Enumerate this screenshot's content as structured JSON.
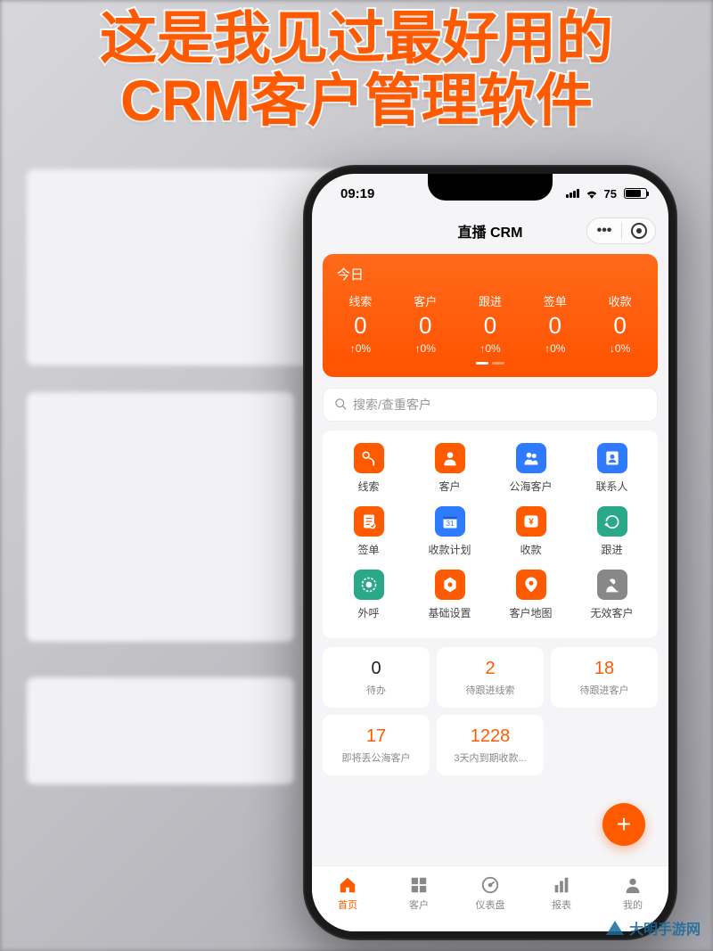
{
  "headline_line1": "这是我见过最好用的",
  "headline_line2": "CRM客户管理软件",
  "status": {
    "time": "09:19",
    "battery_pct": "75"
  },
  "titlebar": {
    "title": "直播 CRM"
  },
  "stats": {
    "period": "今日",
    "items": [
      {
        "label": "线索",
        "value": "0",
        "delta": "↑0%"
      },
      {
        "label": "客户",
        "value": "0",
        "delta": "↑0%"
      },
      {
        "label": "跟进",
        "value": "0",
        "delta": "↑0%"
      },
      {
        "label": "签单",
        "value": "0",
        "delta": "↑0%"
      },
      {
        "label": "收款",
        "value": "0",
        "delta": "↓0%"
      }
    ]
  },
  "search": {
    "placeholder": "搜索/查重客户"
  },
  "functions": [
    {
      "name": "leads",
      "label": "线索",
      "bg": "#ff5a00"
    },
    {
      "name": "customers",
      "label": "客户",
      "bg": "#ff5a00"
    },
    {
      "name": "pool",
      "label": "公海客户",
      "bg": "#2f7bff"
    },
    {
      "name": "contacts",
      "label": "联系人",
      "bg": "#2f7bff"
    },
    {
      "name": "contracts",
      "label": "签单",
      "bg": "#ff5a00"
    },
    {
      "name": "payplan",
      "label": "收款计划",
      "bg": "#2f7bff"
    },
    {
      "name": "payments",
      "label": "收款",
      "bg": "#ff5a00"
    },
    {
      "name": "followup",
      "label": "跟进",
      "bg": "#2aa98a"
    },
    {
      "name": "outcall",
      "label": "外呼",
      "bg": "#2aa98a"
    },
    {
      "name": "settings",
      "label": "基础设置",
      "bg": "#ff5a00"
    },
    {
      "name": "map",
      "label": "客户地图",
      "bg": "#ff5a00"
    },
    {
      "name": "invalid",
      "label": "无效客户",
      "bg": "#888"
    }
  ],
  "todos": [
    {
      "value": "0",
      "label": "待办",
      "color": "black"
    },
    {
      "value": "2",
      "label": "待跟进线索",
      "color": "orange"
    },
    {
      "value": "18",
      "label": "待跟进客户",
      "color": "orange"
    },
    {
      "value": "17",
      "label": "即将丢公海客户",
      "color": "orange"
    },
    {
      "value": "1228",
      "label": "3天内到期收款...",
      "color": "orange"
    }
  ],
  "tabs": [
    {
      "name": "home",
      "label": "首页",
      "active": true
    },
    {
      "name": "customers",
      "label": "客户",
      "active": false
    },
    {
      "name": "dashboard",
      "label": "仪表盘",
      "active": false
    },
    {
      "name": "reports",
      "label": "报表",
      "active": false
    },
    {
      "name": "me",
      "label": "我的",
      "active": false
    }
  ],
  "fab": "+",
  "watermark": "大明手游网"
}
